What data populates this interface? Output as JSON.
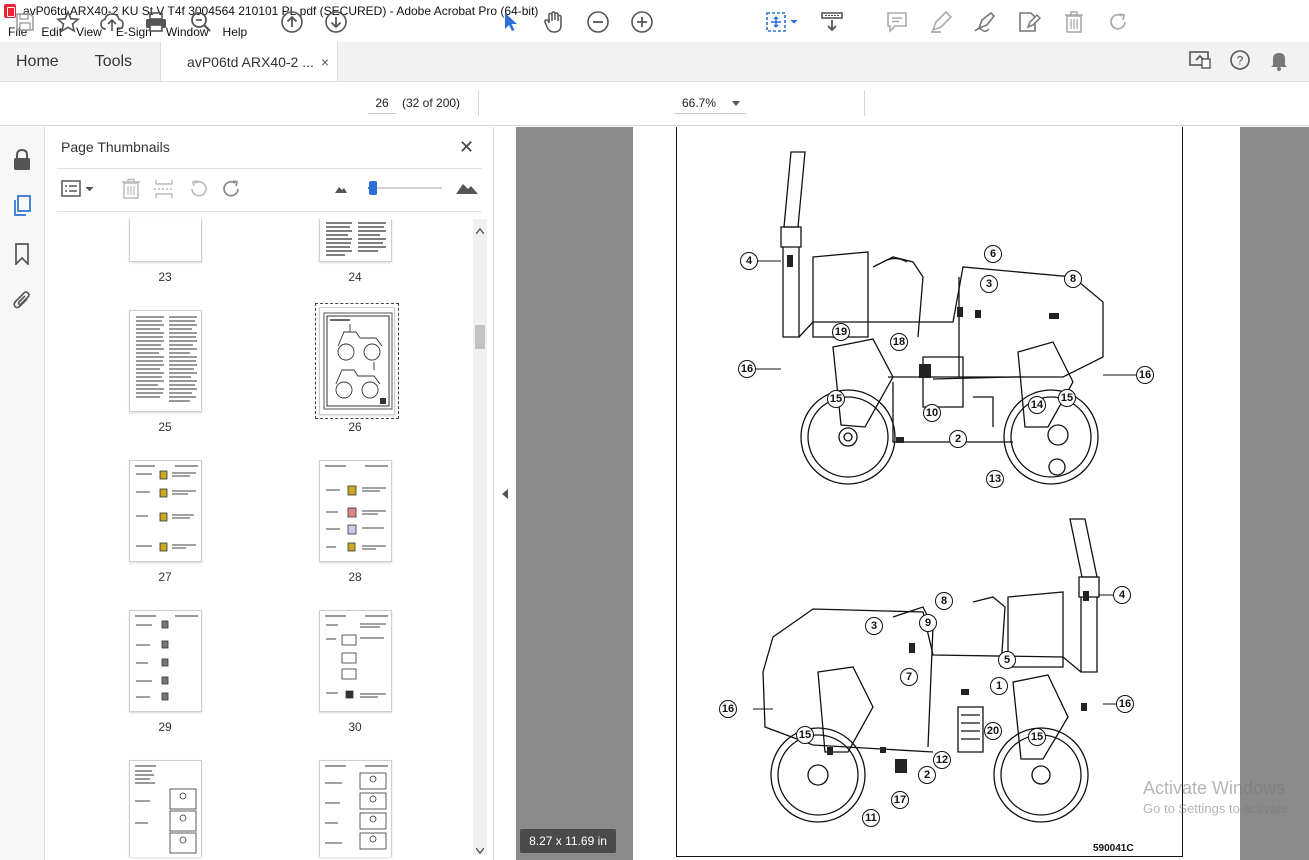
{
  "window": {
    "title": "avP06td ARX40-2 KU St V T4f 3004564 210101 PL.pdf (SECURED) - Adobe Acrobat Pro (64-bit)"
  },
  "menu": [
    "File",
    "Edit",
    "View",
    "E-Sign",
    "Window",
    "Help"
  ],
  "tabs": {
    "home": "Home",
    "tools": "Tools",
    "document": "avP06td ARX40-2 ...",
    "close_glyph": "×"
  },
  "toolbar": {
    "page_number": "26",
    "page_count": "(32 of 200)",
    "zoom": "66.7%"
  },
  "thumbnails_panel": {
    "title": "Page Thumbnails",
    "close_glyph": "✕",
    "pages": [
      {
        "label": "23"
      },
      {
        "label": "24"
      },
      {
        "label": "25"
      },
      {
        "label": "26",
        "selected": true
      },
      {
        "label": "27"
      },
      {
        "label": "28"
      },
      {
        "label": "29"
      },
      {
        "label": "30"
      },
      {
        "label": "",
        "partial": true
      },
      {
        "label": "",
        "partial": true
      }
    ]
  },
  "document_page": {
    "callouts_top": [
      "4",
      "6",
      "3",
      "8",
      "19",
      "18",
      "16",
      "16",
      "15",
      "10",
      "2",
      "14",
      "15",
      "13"
    ],
    "callouts_bottom": [
      "4",
      "8",
      "9",
      "3",
      "5",
      "7",
      "1",
      "16",
      "16",
      "20",
      "15",
      "15",
      "12",
      "2",
      "17",
      "11"
    ],
    "figure_code": "590041C"
  },
  "status": {
    "page_size": "8.27 x 11.69 in"
  },
  "watermark": {
    "line1": "Activate Windows",
    "line2": "Go to Settings to activate"
  },
  "colors": {
    "accent": "#2c6fd6",
    "doc_background": "#8b8b8b",
    "pdf_icon": "#e23"
  }
}
